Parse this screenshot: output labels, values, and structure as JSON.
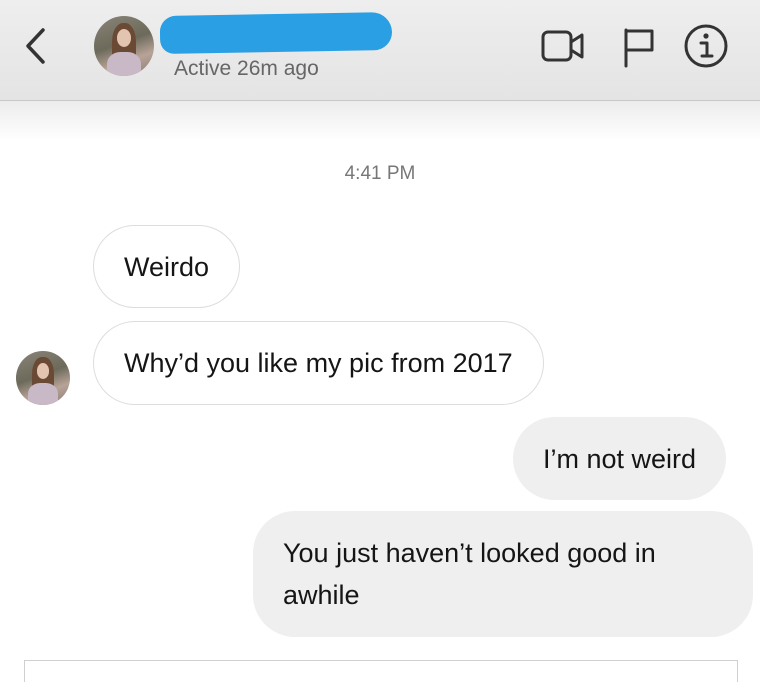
{
  "header": {
    "back_icon": "chevron-left-icon",
    "contact_name": "",
    "active_status": "Active 26m ago",
    "icons": [
      "video-call-icon",
      "flag-icon",
      "info-icon"
    ]
  },
  "conversation": {
    "timestamp": "4:41 PM",
    "messages": [
      {
        "from": "them",
        "text": "Weirdo"
      },
      {
        "from": "them",
        "text": "Why’d you like my pic from 2017"
      },
      {
        "from": "me",
        "text": "I’m not weird"
      },
      {
        "from": "me",
        "text": "You just haven’t looked good in awhile"
      }
    ]
  },
  "colors": {
    "redaction": "#2a9fe3",
    "received_bubble_border": "#dddddd",
    "sent_bubble_bg": "#efefef",
    "header_bg": "#e8e8e8"
  }
}
